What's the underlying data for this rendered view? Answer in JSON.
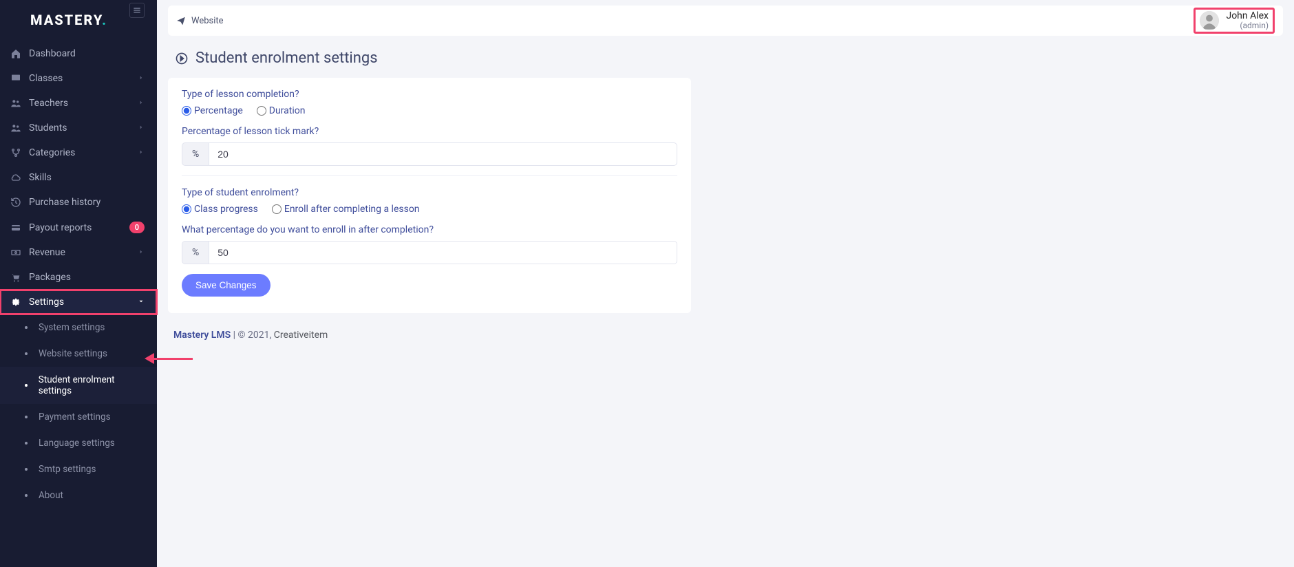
{
  "logo": {
    "text": "MASTERY",
    "dot": "."
  },
  "sidebar": {
    "items": [
      {
        "label": "Dashboard",
        "chevron": false
      },
      {
        "label": "Classes",
        "chevron": true
      },
      {
        "label": "Teachers",
        "chevron": true
      },
      {
        "label": "Students",
        "chevron": true
      },
      {
        "label": "Categories",
        "chevron": true
      },
      {
        "label": "Skills",
        "chevron": false
      },
      {
        "label": "Purchase history",
        "chevron": false
      },
      {
        "label": "Payout reports",
        "chevron": false,
        "badge": "0"
      },
      {
        "label": "Revenue",
        "chevron": true
      },
      {
        "label": "Packages",
        "chevron": false
      },
      {
        "label": "Settings",
        "chevron": true
      }
    ],
    "settings_sub": [
      {
        "label": "System settings"
      },
      {
        "label": "Website settings"
      },
      {
        "label": "Student enrolment settings"
      },
      {
        "label": "Payment settings"
      },
      {
        "label": "Language settings"
      },
      {
        "label": "Smtp settings"
      },
      {
        "label": "About"
      }
    ]
  },
  "topbar": {
    "link": "Website"
  },
  "user": {
    "name": "John Alex",
    "role": "(admin)"
  },
  "page": {
    "title": "Student enrolment settings"
  },
  "form": {
    "q1": "Type of lesson completion?",
    "q1_opt1": "Percentage",
    "q1_opt2": "Duration",
    "q2": "Percentage of lesson tick mark?",
    "addon": "%",
    "v1": "20",
    "q3": "Type of student enrolment?",
    "q3_opt1": "Class progress",
    "q3_opt2": "Enroll after completing a lesson",
    "q4": "What percentage do you want to enroll in after completion?",
    "v2": "50",
    "submit": "Save Changes"
  },
  "footer": {
    "brand": "Mastery LMS",
    "mid": " | © 2021, ",
    "link": "Creativeitem"
  }
}
